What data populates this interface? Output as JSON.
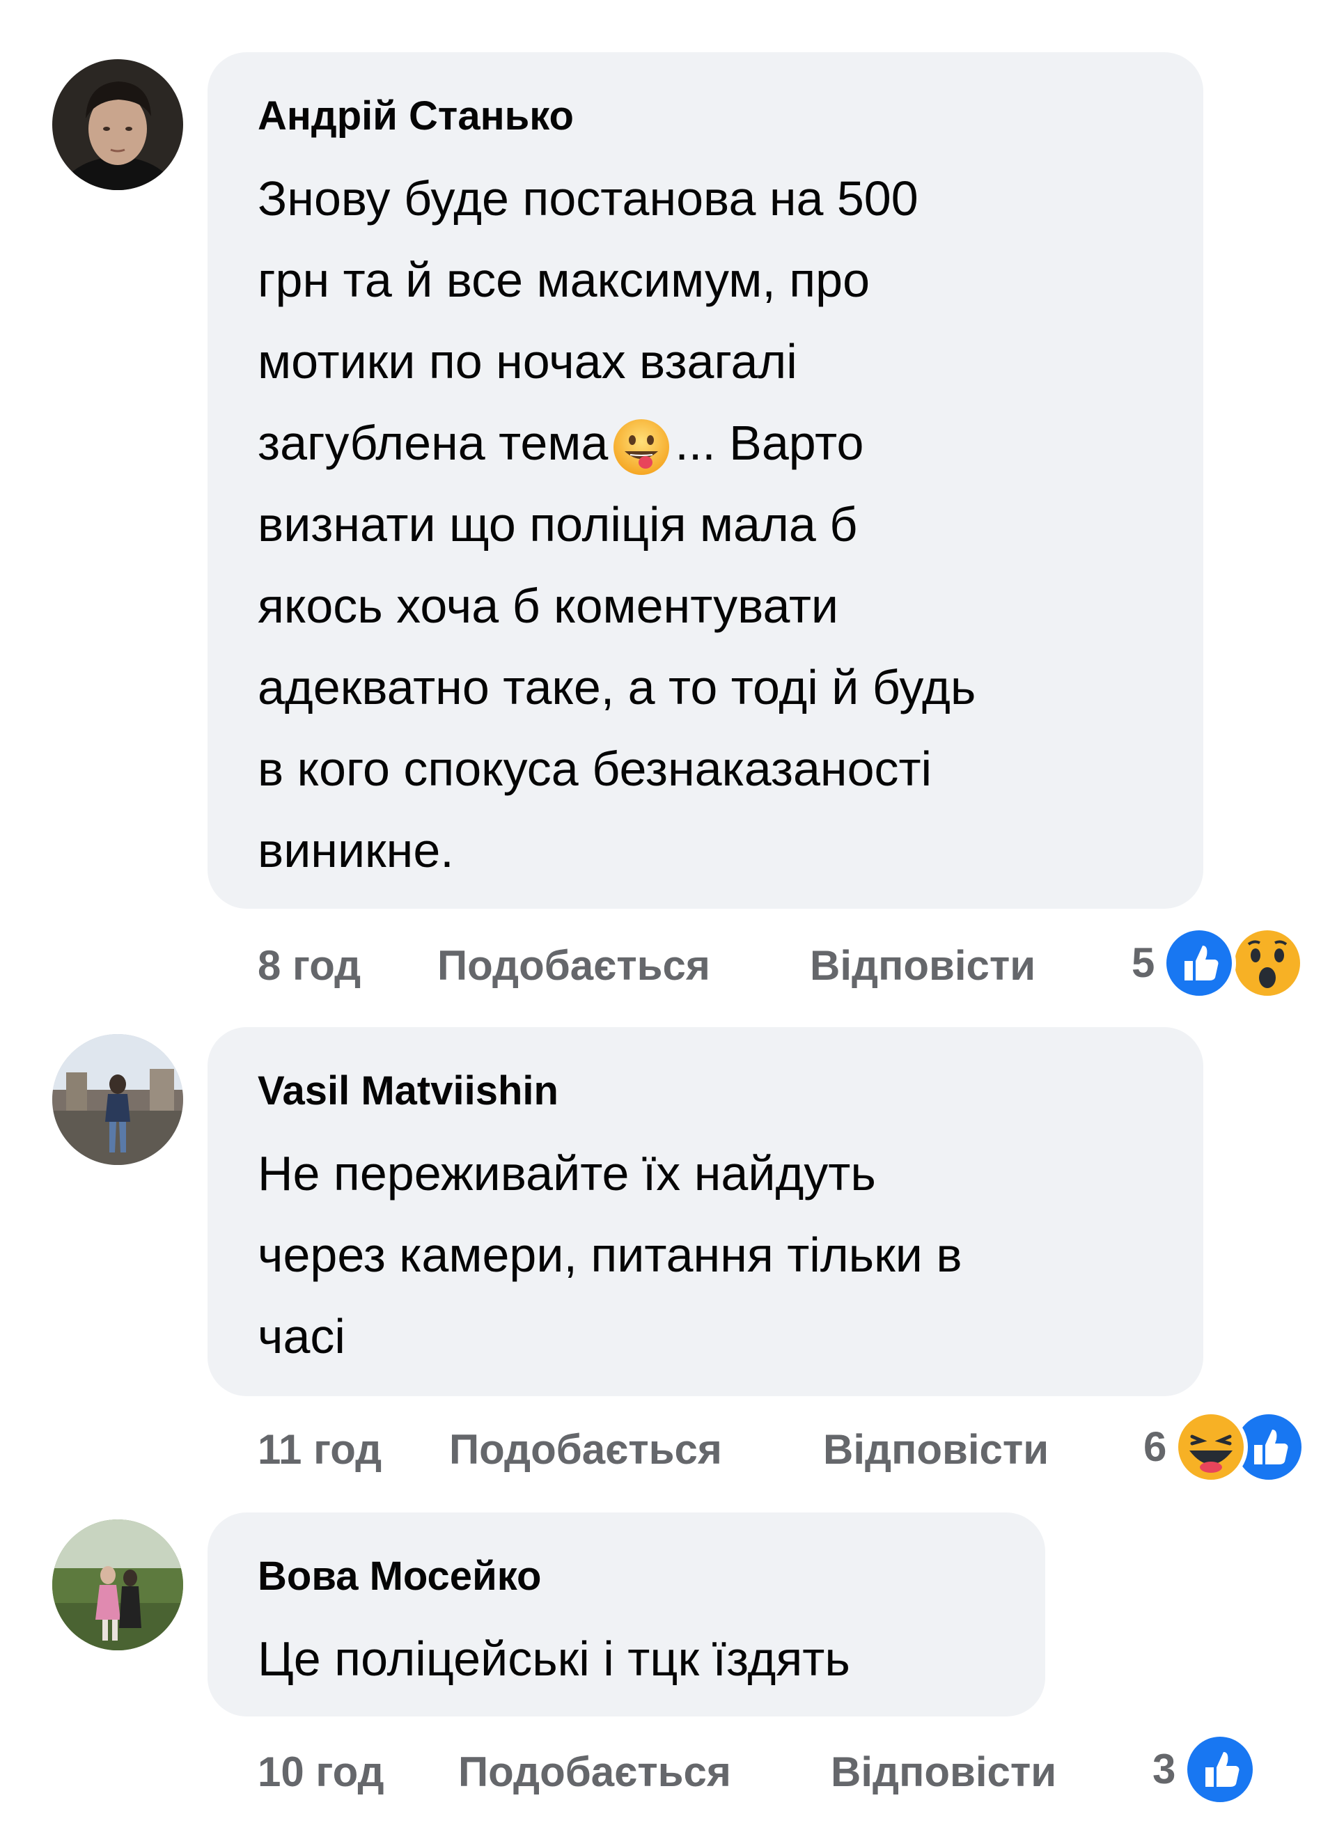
{
  "comments": [
    {
      "author": "Андрій Станько",
      "lines": [
        "Знову буде постанова на 500",
        "грн та й все максимум, про",
        "мотики по ночах взагалі",
        "загублена тема",
        "визнати що поліція мала б",
        "якось хоча б коментувати",
        "адекватно таке, а то тоді й будь",
        "в кого спокуса безнаказаності",
        "виникне."
      ],
      "line4_after_emoji": "... Варто",
      "time": "8 год",
      "like_label": "Подобається",
      "reply_label": "Відповісти",
      "reaction_count": "5",
      "reactions": [
        "like-icon",
        "wow-icon"
      ]
    },
    {
      "author": "Vasil Matviishin",
      "lines": [
        "Не переживайте їх найдуть",
        "через камери, питання тільки в",
        "часі"
      ],
      "time": "11 год",
      "like_label": "Подобається",
      "reply_label": "Відповісти",
      "reaction_count": "6",
      "reactions": [
        "haha-icon",
        "like-icon"
      ]
    },
    {
      "author": "Вова Мосейко",
      "lines": [
        "Це поліцейські і тцк їздять"
      ],
      "time": "10 год",
      "like_label": "Подобається",
      "reply_label": "Відповісти",
      "reaction_count": "3",
      "reactions": [
        "like-icon"
      ]
    }
  ],
  "colors": {
    "bubble": "#f0f2f5",
    "text": "#050505",
    "meta": "#65676b",
    "like_blue": "#1877f2",
    "emoji_yellow": "#f7b125"
  }
}
